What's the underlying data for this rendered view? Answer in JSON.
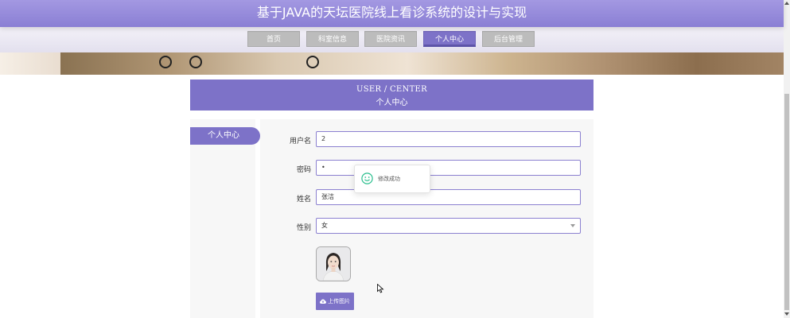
{
  "app": {
    "title": "基于JAVA的天坛医院线上看诊系统的设计与实现"
  },
  "nav": {
    "items": [
      {
        "label": "首页"
      },
      {
        "label": "科室信息"
      },
      {
        "label": "医院资讯"
      },
      {
        "label": "个人中心",
        "active": true
      },
      {
        "label": "后台管理"
      }
    ]
  },
  "section": {
    "title_en": "USER / CENTER",
    "title_cn": "个人中心"
  },
  "sidebar": {
    "items": [
      {
        "label": "个人中心",
        "active": true
      }
    ]
  },
  "form": {
    "username": {
      "label": "用户名",
      "value": "2"
    },
    "password": {
      "label": "密码",
      "value": "•"
    },
    "name": {
      "label": "姓名",
      "value": "张洁"
    },
    "gender": {
      "label": "性别",
      "value": "女"
    },
    "upload_label": "上传图片"
  },
  "toast": {
    "message": "修改成功"
  },
  "colors": {
    "accent": "#7d72c8",
    "header": "#8a7fd4",
    "toast_icon": "#2bbf8e"
  }
}
